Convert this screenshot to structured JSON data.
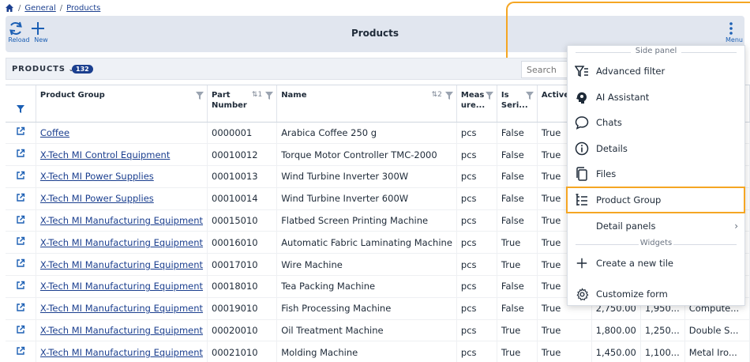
{
  "breadcrumb": {
    "items": [
      "General",
      "Products"
    ]
  },
  "toolbar": {
    "reload_label": "Reload",
    "new_label": "New",
    "title": "Products",
    "menu_label": "Menu"
  },
  "list": {
    "title": "PRODUCTS",
    "count": "132",
    "search_placeholder": "Search"
  },
  "table": {
    "headers": {
      "product_group": "Product Group",
      "part_number": "Part Number",
      "part_number_sort": "1",
      "name": "Name",
      "name_sort": "2",
      "measure": "Meas ure...",
      "is_serial": "Is Seri...",
      "active": "Active"
    },
    "rows": [
      {
        "group": "Coffee",
        "part": "0000001",
        "name": "Arabica Coffee 250 g",
        "measure": "pcs",
        "serial": "False",
        "active": "True",
        "c1": "",
        "c2": "",
        "c3": ""
      },
      {
        "group": "X-Tech MI Control Equipment",
        "part": "00010012",
        "name": "Torque Motor Controller TMC-2000",
        "measure": "pcs",
        "serial": "False",
        "active": "True",
        "c1": "",
        "c2": "",
        "c3": ""
      },
      {
        "group": "X-Tech MI Power Supplies",
        "part": "00010013",
        "name": "Wind Turbine Inverter 300W",
        "measure": "pcs",
        "serial": "False",
        "active": "True",
        "c1": "",
        "c2": "",
        "c3": ""
      },
      {
        "group": "X-Tech MI Power Supplies",
        "part": "00010014",
        "name": "Wind Turbine Inverter 600W",
        "measure": "pcs",
        "serial": "False",
        "active": "True",
        "c1": "",
        "c2": "",
        "c3": ""
      },
      {
        "group": "X-Tech MI Manufacturing Equipment",
        "part": "00015010",
        "name": "Flatbed Screen Printing Machine",
        "measure": "pcs",
        "serial": "False",
        "active": "True",
        "c1": "",
        "c2": "",
        "c3": ""
      },
      {
        "group": "X-Tech MI Manufacturing Equipment",
        "part": "00016010",
        "name": "Automatic Fabric Laminating Machine",
        "measure": "pcs",
        "serial": "True",
        "active": "True",
        "c1": "",
        "c2": "",
        "c3": ""
      },
      {
        "group": "X-Tech MI Manufacturing Equipment",
        "part": "00017010",
        "name": "Wire Machine",
        "measure": "pcs",
        "serial": "True",
        "active": "True",
        "c1": "",
        "c2": "",
        "c3": ""
      },
      {
        "group": "X-Tech MI Manufacturing Equipment",
        "part": "00018010",
        "name": "Tea Packing Machine",
        "measure": "pcs",
        "serial": "False",
        "active": "True",
        "c1": "",
        "c2": "",
        "c3": ""
      },
      {
        "group": "X-Tech MI Manufacturing Equipment",
        "part": "00019010",
        "name": "Fish Processing Machine",
        "measure": "pcs",
        "serial": "False",
        "active": "True",
        "c1": "2,750.00",
        "c2": "1,950...",
        "c3": "Compute..."
      },
      {
        "group": "X-Tech MI Manufacturing Equipment",
        "part": "00020010",
        "name": "Oil Treatment Machine",
        "measure": "pcs",
        "serial": "True",
        "active": "True",
        "c1": "1,800.00",
        "c2": "1,250...",
        "c3": "Double S..."
      },
      {
        "group": "X-Tech MI Manufacturing Equipment",
        "part": "00021010",
        "name": "Molding Machine",
        "measure": "pcs",
        "serial": "True",
        "active": "True",
        "c1": "1,450.00",
        "c2": "1,100...",
        "c3": "Metal Iro..."
      }
    ]
  },
  "menu": {
    "section_side_panel": "Side panel",
    "section_widgets": "Widgets",
    "items": [
      {
        "label": "Advanced filter",
        "icon": "advanced-filter-icon"
      },
      {
        "label": "AI Assistant",
        "icon": "ai-assistant-icon"
      },
      {
        "label": "Chats",
        "icon": "chat-icon"
      },
      {
        "label": "Details",
        "icon": "info-icon"
      },
      {
        "label": "Files",
        "icon": "files-icon"
      },
      {
        "label": "Product Group",
        "icon": "product-group-icon"
      },
      {
        "label": "Detail panels",
        "icon": ""
      },
      {
        "label": "Create a new tile",
        "icon": "plus-icon"
      },
      {
        "label": "Customize form",
        "icon": "gear-icon"
      }
    ]
  },
  "colors": {
    "accent": "#1b5fb4",
    "link": "#1b3f8f",
    "highlight": "#f5a623",
    "toolbar_bg": "#e1e6ef"
  }
}
